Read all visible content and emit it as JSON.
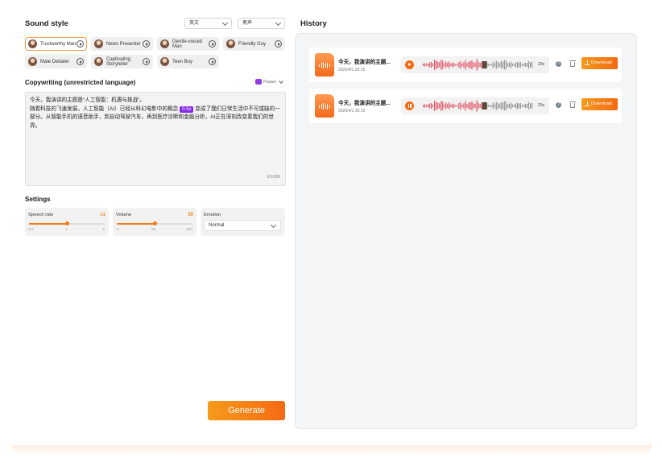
{
  "sound_style": {
    "title": "Sound style",
    "language_select": "英文",
    "gender_select": "男声",
    "voices": [
      {
        "label": "Trustworthy Man",
        "active": true
      },
      {
        "label": "News Presenter",
        "active": false
      },
      {
        "label": "Gentle-voiced Man",
        "active": false
      },
      {
        "label": "Friendly Guy",
        "active": false
      },
      {
        "label": "Male Debater",
        "active": false
      },
      {
        "label": "Captivating Storyteller",
        "active": false
      },
      {
        "label": "Teen Boy",
        "active": false
      }
    ]
  },
  "copywriting": {
    "title": "Copywriting (unrestricted language)",
    "pause_label": "Pause",
    "text_part1": "今天，我演讲的主题是“人工智能：机遇与挑战”。\n随着科技的飞速发展，人工智能（AI）已经从科幻电影中的概念",
    "pause_chip": "0.5s",
    "text_part2": "变成了我们日常生活中不可或缺的一部分。从智能手机的语音助手，到自动驾驶汽车，再到医疗诊断和金融分析，AI正在深刻改变着我们的世界。",
    "counter": "0/1000"
  },
  "settings": {
    "title": "Settings",
    "speech_rate": {
      "label": "Speech rate",
      "value_label": "x1",
      "fraction": 0.5,
      "ticks": [
        "0.5",
        "1",
        "2"
      ]
    },
    "volume": {
      "label": "Volume",
      "value_label": "50",
      "fraction": 0.5,
      "ticks": [
        "0",
        "50",
        "100"
      ]
    },
    "emotion": {
      "label": "Emotion",
      "value": "Normal"
    }
  },
  "generate_label": "Generate",
  "history": {
    "title": "History",
    "items": [
      {
        "title": "今天，我演讲的主题...",
        "date": "2025/4/1 20:15",
        "duration": "20s",
        "state": "play",
        "progress": 0.56,
        "download_label": "Download"
      },
      {
        "title": "今天，我演讲的主题...",
        "date": "2025/4/1 20:15",
        "duration": "20s",
        "state": "pause",
        "progress": 0.56,
        "download_label": "Download"
      }
    ]
  },
  "colors": {
    "accent": "#f56a12",
    "played_wave": "#e0485a",
    "unplayed_wave": "#8c8c8c",
    "pause_chip": "#8428e6"
  },
  "icons": [
    "avatar",
    "play-icon",
    "pause-icon",
    "help-icon",
    "trash-icon",
    "download-icon",
    "audio-file-icon",
    "chevron-down-icon"
  ]
}
